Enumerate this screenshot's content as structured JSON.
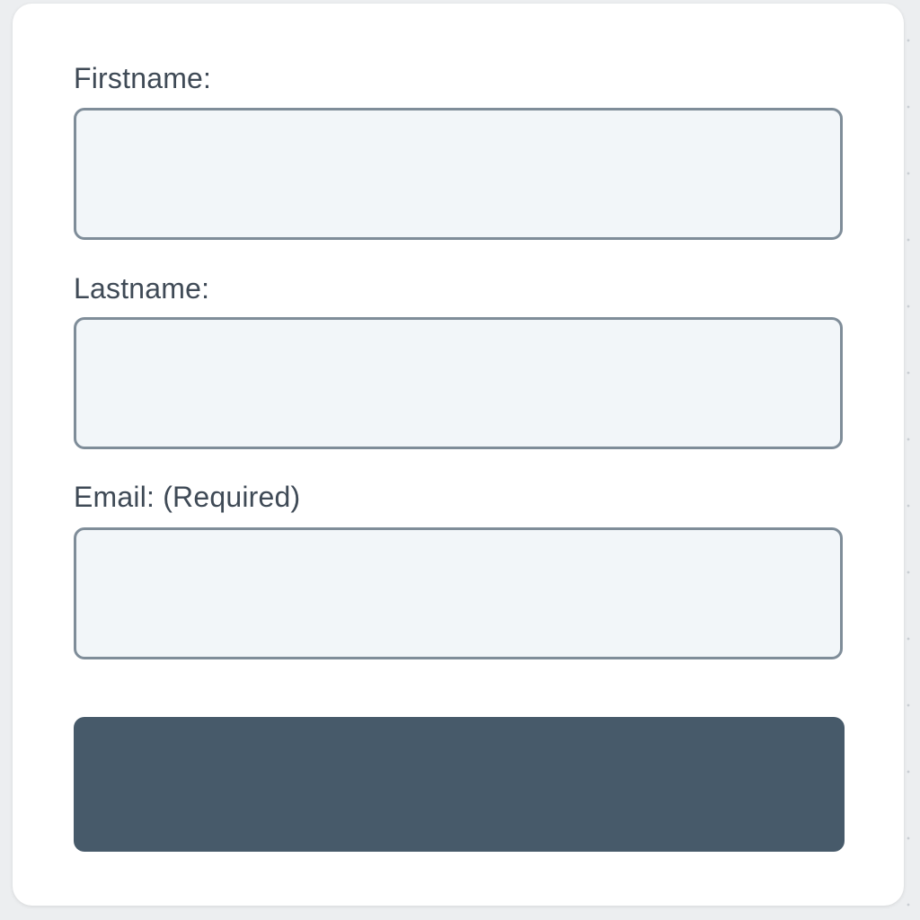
{
  "form": {
    "fields": [
      {
        "label": "Firstname:",
        "value": "",
        "placeholder": ""
      },
      {
        "label": "Lastname:",
        "value": "",
        "placeholder": ""
      },
      {
        "label": "Email: (Required)",
        "value": "",
        "placeholder": ""
      }
    ],
    "submit_label": ""
  },
  "colors": {
    "input_border": "#7f8d99",
    "input_background": "#f2f6f9",
    "button_background": "#475a6a",
    "label_text": "#3f4a56"
  }
}
